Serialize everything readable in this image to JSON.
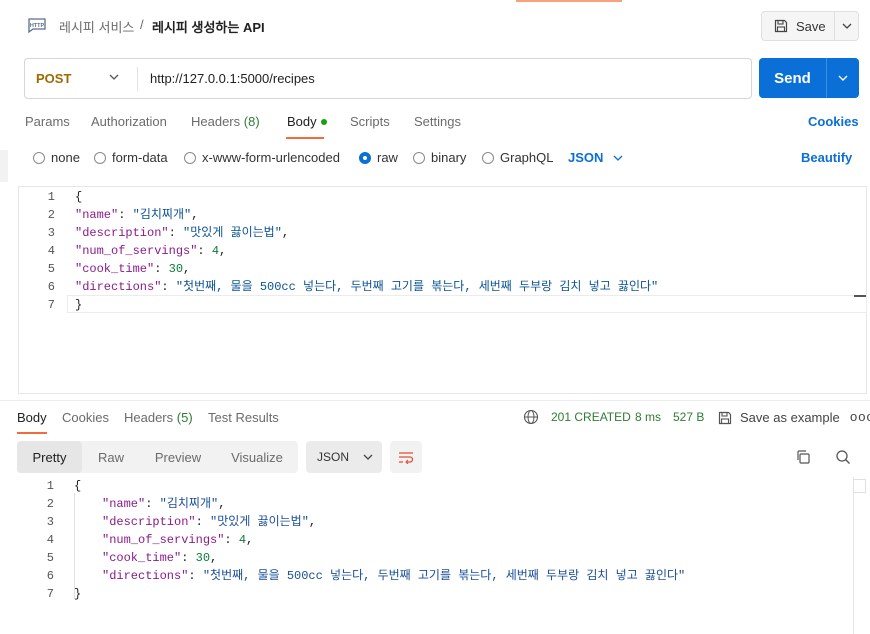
{
  "header": {
    "breadcrumb_parent": "레시피 서비스",
    "breadcrumb_sep": "/",
    "breadcrumb_current": "레시피 생성하는 API",
    "save_label": "Save"
  },
  "request": {
    "method": "POST",
    "url": "http://127.0.0.1:5000/recipes",
    "send_label": "Send"
  },
  "request_tabs": [
    {
      "label": "Params"
    },
    {
      "label": "Authorization"
    },
    {
      "label": "Headers",
      "count": "(8)"
    },
    {
      "label": "Body"
    },
    {
      "label": "Scripts"
    },
    {
      "label": "Settings"
    }
  ],
  "cookies_label": "Cookies",
  "body_types": [
    "none",
    "form-data",
    "x-www-form-urlencoded",
    "raw",
    "binary",
    "GraphQL"
  ],
  "body_format": "JSON",
  "beautify_label": "Beautify",
  "request_body": {
    "line_numbers": [
      "1",
      "2",
      "3",
      "4",
      "5",
      "6",
      "7"
    ],
    "open_brace": "{",
    "close_brace": "}",
    "fields": [
      {
        "key": "\"name\"",
        "value": "\"김치찌개\"",
        "type": "string"
      },
      {
        "key": "\"description\"",
        "value": "\"맛있게 끓이는법\"",
        "type": "string"
      },
      {
        "key": "\"num_of_servings\"",
        "value": "4",
        "type": "number"
      },
      {
        "key": "\"cook_time\"",
        "value": "30",
        "type": "number"
      },
      {
        "key": "\"directions\"",
        "value": "\"첫번째, 물을 500cc 넣는다, 두번째 고기를 볶는다, 세번째 두부랑 김치 넣고 끓인다\"",
        "type": "string"
      }
    ]
  },
  "response_tabs": [
    {
      "label": "Body"
    },
    {
      "label": "Cookies"
    },
    {
      "label": "Headers",
      "count": "(5)"
    },
    {
      "label": "Test Results"
    }
  ],
  "response_status": {
    "code": "201 CREATED",
    "time": "8 ms",
    "size": "527 B",
    "save_example_label": "Save as example",
    "more": "ooo"
  },
  "response_views": [
    "Pretty",
    "Raw",
    "Preview",
    "Visualize"
  ],
  "response_format": "JSON",
  "response_body": {
    "line_numbers": [
      "1",
      "2",
      "3",
      "4",
      "5",
      "6",
      "7"
    ],
    "open_brace": "{",
    "close_brace": "}",
    "fields": [
      {
        "key": "\"name\"",
        "value": "\"김치찌개\"",
        "type": "string"
      },
      {
        "key": "\"description\"",
        "value": "\"맛있게 끓이는법\"",
        "type": "string"
      },
      {
        "key": "\"num_of_servings\"",
        "value": "4",
        "type": "number"
      },
      {
        "key": "\"cook_time\"",
        "value": "30",
        "type": "number"
      },
      {
        "key": "\"directions\"",
        "value": "\"첫번째, 물을 500cc 넣는다, 두번째 고기를 볶는다, 세번째 두부랑 김치 넣고 끓인다\"",
        "type": "string"
      }
    ]
  },
  "colors": {
    "accent": "#0a6fd6",
    "tab_underline": "#f26b3a",
    "status_ok": "#2e7d32",
    "method_post": "#9c6b00"
  },
  "icons": {
    "http": "http-icon",
    "save": "floppy-disk-icon",
    "globe": "globe-icon",
    "copy": "copy-icon",
    "search": "search-icon",
    "wrap": "wrap-lines-icon"
  }
}
